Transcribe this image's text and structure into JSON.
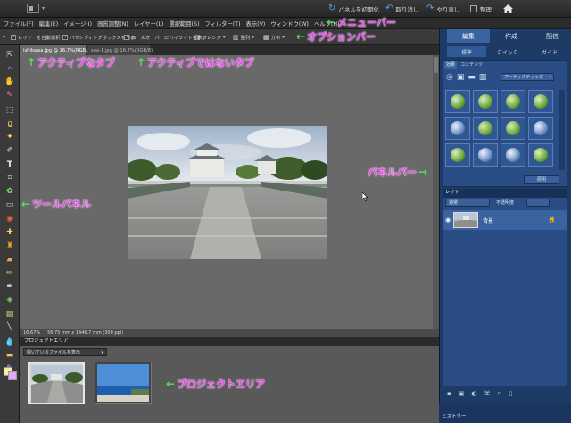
{
  "topbar": {
    "reset_panels": "パネルを初期化",
    "undo": "取り消し",
    "redo": "やり直し",
    "organizer": "整理"
  },
  "menubar": {
    "items": [
      "ファイル(F)",
      "編集(E)",
      "イメージ(I)",
      "画質調整(N)",
      "レイヤー(L)",
      "選択範囲(S)",
      "フィルター(T)",
      "表示(V)",
      "ウィンドウ(W)",
      "ヘルプ(H)"
    ]
  },
  "optionsbar": {
    "auto_select_layer": "レイヤーを自動選択",
    "show_bbox": "バウンディングボックスを表示",
    "rollover_highlight": "ロールオーバーにハイライトを表示",
    "arrange": "アレンジ",
    "align": "整列",
    "distribute": "分布"
  },
  "document": {
    "tabs": [
      "ishikawa.jpg @ 16.7%(RGB/8)",
      "sea-1.jpg @ 16.7%(RGB/8)"
    ],
    "zoom": "16.67%",
    "doc_size": "56.75 mm x 1446.7 mm (300 ppi)"
  },
  "project_area": {
    "title": "プロジェクトエリア",
    "dropdown": "開いているファイルを表示"
  },
  "panel": {
    "tabs": [
      "編集",
      "作成",
      "配信"
    ],
    "subtabs": [
      "標準",
      "クイック",
      "ガイド"
    ],
    "effects_tabs": [
      "効果",
      "コンテンツ"
    ],
    "effects_dropdown": "アーティスティック",
    "apply_button": "適用",
    "layers_title": "レイヤー",
    "blend_mode": "通常",
    "opacity_label": "不透明度",
    "layer_name": "背景",
    "history_title": "ヒストリー"
  },
  "annotations": {
    "menubar": "メニューバー",
    "optionsbar": "オプションバー",
    "active_tab": "アクティブなタブ",
    "inactive_tab": "アクティブではないタブ",
    "panel_bar": "パネルバー",
    "tool_panel": "ツールパネル",
    "project_area": "プロジェクトエリア"
  },
  "colors": {
    "annotation_text": "#f040f0",
    "annotation_arrow": "#55e055",
    "panel_bg": "#1e3b66"
  }
}
